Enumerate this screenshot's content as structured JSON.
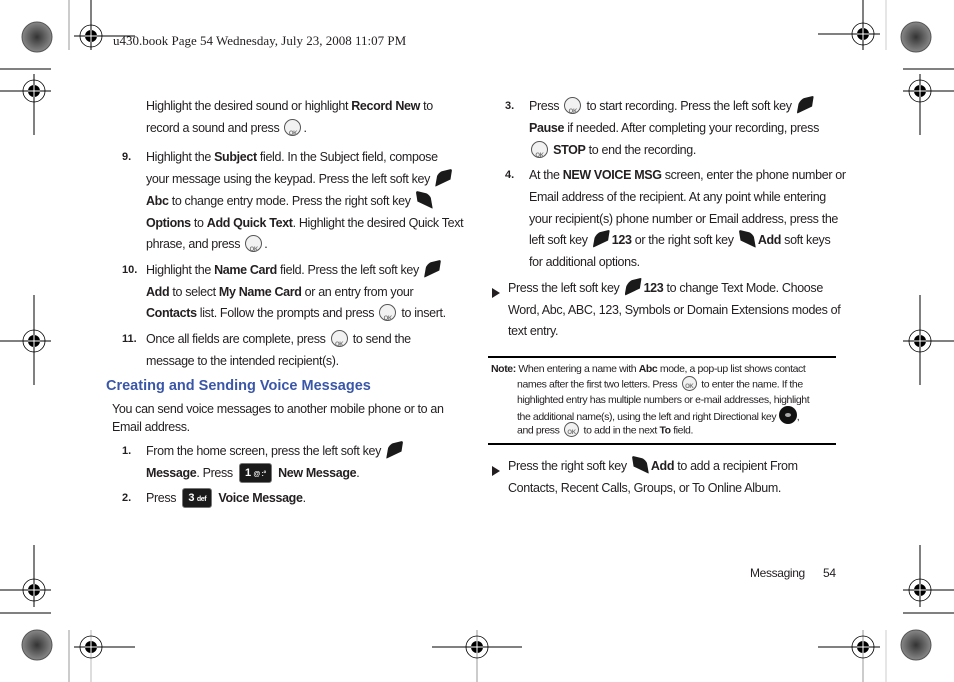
{
  "header": {
    "text": "u430.book  Page 54  Wednesday, July 23, 2008  11:07 PM"
  },
  "left": {
    "intro": {
      "line1_a": "Highlight the desired sound or highlight ",
      "line1_b": "Record New",
      "line1_c": " to",
      "line2_a": "record a sound and press ",
      "line2_c": "."
    },
    "step9": {
      "num": "9.",
      "l1_a": "Highlight the ",
      "l1_b": "Subject",
      "l1_c": " field. In the Subject field, compose",
      "l2": "your message using the keypad. Press the left soft key",
      "l3_b": "Abc",
      "l3_c": " to change entry mode. Press the right soft key",
      "l4_b": "Options",
      "l4_c": " to ",
      "l4_d": "Add Quick Text",
      "l4_e": ". Highlight the desired Quick Text",
      "l5_a": "phrase, and press ",
      "l5_c": "."
    },
    "step10": {
      "num": "10.",
      "l1_a": "Highlight the ",
      "l1_b": "Name Card",
      "l1_c": " field. Press the left soft key",
      "l2_b": "Add",
      "l2_c": " to select ",
      "l2_d": "My Name Card",
      "l2_e": " or an entry from your",
      "l3_b": "Contacts",
      "l3_c": " list. Follow the prompts and press ",
      "l3_e": " to insert."
    },
    "step11": {
      "num": "11.",
      "l1_a": "Once all fields are complete, press ",
      "l1_c": " to send the",
      "l2": "message to the intended recipient(s)."
    },
    "heading": "Creating and Sending Voice Messages",
    "para_l1": "You can send voice messages to another mobile phone or to an",
    "para_l2": "Email address.",
    "step1": {
      "num": "1.",
      "l1": "From the home screen, press the left soft key",
      "l2_b": "Message",
      "l2_c": ". Press ",
      "key": "1",
      "key_sub": "@ :°",
      "l2_e": "New Message",
      "l2_f": "."
    },
    "step2": {
      "num": "2.",
      "l1_a": "Press ",
      "key": "3",
      "key_sub": "def",
      "l1_b": "Voice Message",
      "l1_c": "."
    }
  },
  "right": {
    "step3": {
      "num": "3.",
      "l1_a": "Press ",
      "l1_c": " to start recording. Press the left soft key",
      "l2_b": "Pause",
      "l2_c": " if needed. After completing your recording, press",
      "l3_b": "STOP",
      "l3_c": " to end the recording."
    },
    "step4": {
      "num": "4.",
      "l1_a": "At the ",
      "l1_b": "NEW VOICE MSG",
      "l1_c": " screen, enter the phone number or",
      "l2": "Email address of the recipient. At any point while entering",
      "l3": "your recipient(s) phone number or Email address, press the",
      "l4_a": "left soft key ",
      "l4_b": "123",
      "l4_c": " or the right soft key ",
      "l4_d": "Add",
      "l4_e": " soft keys",
      "l5": "for additional options."
    },
    "bullet1": {
      "l1_a": "Press the left soft key ",
      "l1_b": "123",
      "l1_c": " to change Text Mode. Choose",
      "l2": "Word, Abc, ABC, 123, Symbols or Domain Extensions modes of",
      "l3": "text entry."
    },
    "note": {
      "label": "Note:",
      "l1_a": " When entering a name with ",
      "l1_b": "Abc",
      "l1_c": " mode, a pop-up list shows contact",
      "l2_a": "names after the first two letters. Press ",
      "l2_c": " to enter the name. If the",
      "l3": "highlighted entry has multiple numbers or e-mail addresses, highlight",
      "l4": "the additional name(s), using the left and right Directional key ",
      "l4_end": ",",
      "l5_a": "and press ",
      "l5_c": " to add in the next ",
      "l5_d": "To",
      "l5_e": " field."
    },
    "bullet2": {
      "l1_a": "Press the right soft key ",
      "l1_b": "Add",
      "l1_c": " to add a recipient From",
      "l2": "Contacts, Recent Calls, Groups, or To Online Album."
    }
  },
  "footer": {
    "section": "Messaging",
    "page": "54"
  }
}
